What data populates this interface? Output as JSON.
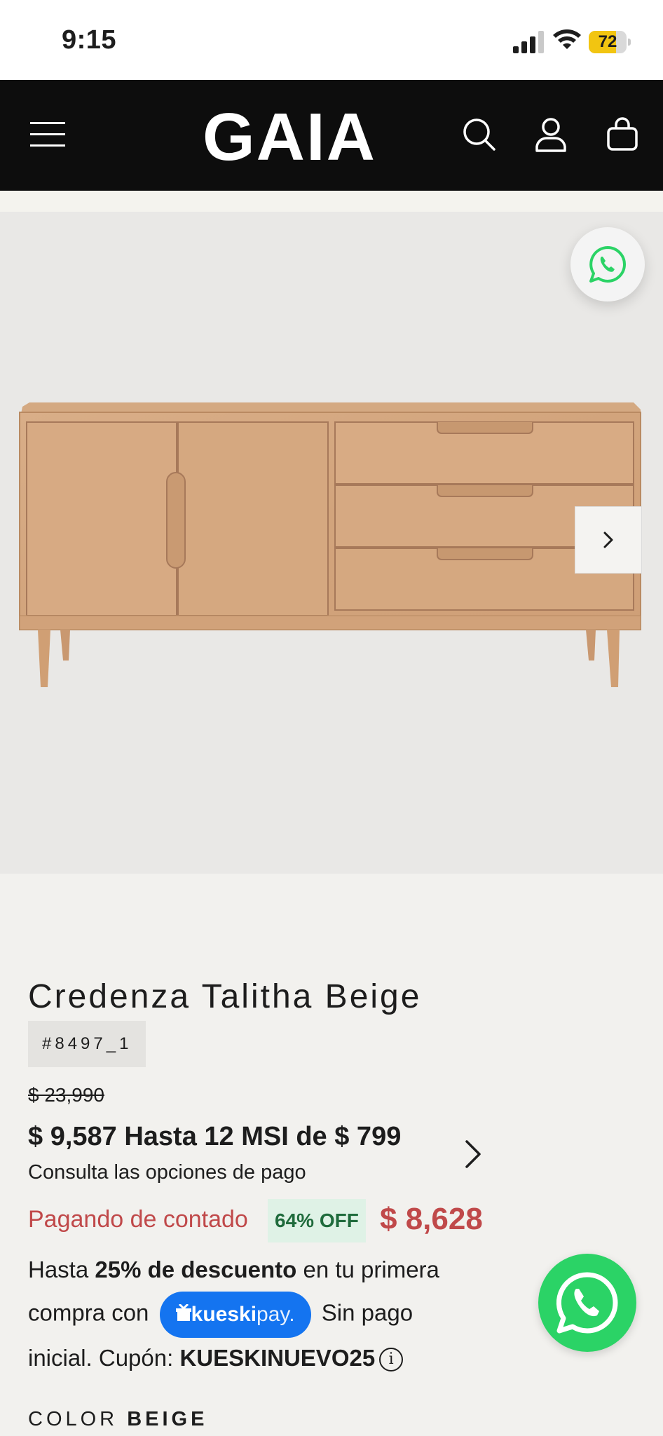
{
  "status_bar": {
    "time": "9:15",
    "battery_level": "72",
    "battery_fraction": 0.72
  },
  "header": {
    "logo_text": "GAIA",
    "menu_icon": "hamburger-menu-icon",
    "search_icon": "search-icon",
    "account_icon": "user-icon",
    "cart_icon": "shopping-bag-icon"
  },
  "gallery": {
    "image_alt": "Credenza Talitha Beige",
    "next_icon": "chevron-right-icon",
    "whatsapp_icon": "whatsapp-icon"
  },
  "product": {
    "title": "Credenza Talitha Beige",
    "sku": "#8497_1",
    "compare_price": "$ 23,990",
    "installments": "$ 9,587 Hasta 12 MSI de $ 799",
    "payment_options": "Consulta las opciones de pago",
    "cash_label": "Pagando de contado",
    "discount_badge": "64% OFF",
    "sale_price": "$ 8,628"
  },
  "promo": {
    "line1_pre": "Hasta ",
    "line1_bold": "25% de descuento",
    "line1_post": " en tu primera",
    "line2_pre": "compra con",
    "kueski_brand": "kueski",
    "kueski_suffix": "pay.",
    "line2_post": "Sin pago",
    "line3_pre": "inicial. Cupón: ",
    "coupon": "KUESKINUEVO25",
    "info_glyph": "i"
  },
  "color": {
    "label": "COLOR",
    "value": "BEIGE"
  },
  "colors": {
    "header_bg": "#0d0d0d",
    "sale_red": "#c0494a",
    "badge_green_bg": "#dff2e6",
    "badge_green_text": "#1f6b3c",
    "kueski_blue": "#1474f0",
    "whatsapp_green": "#2bd366"
  }
}
